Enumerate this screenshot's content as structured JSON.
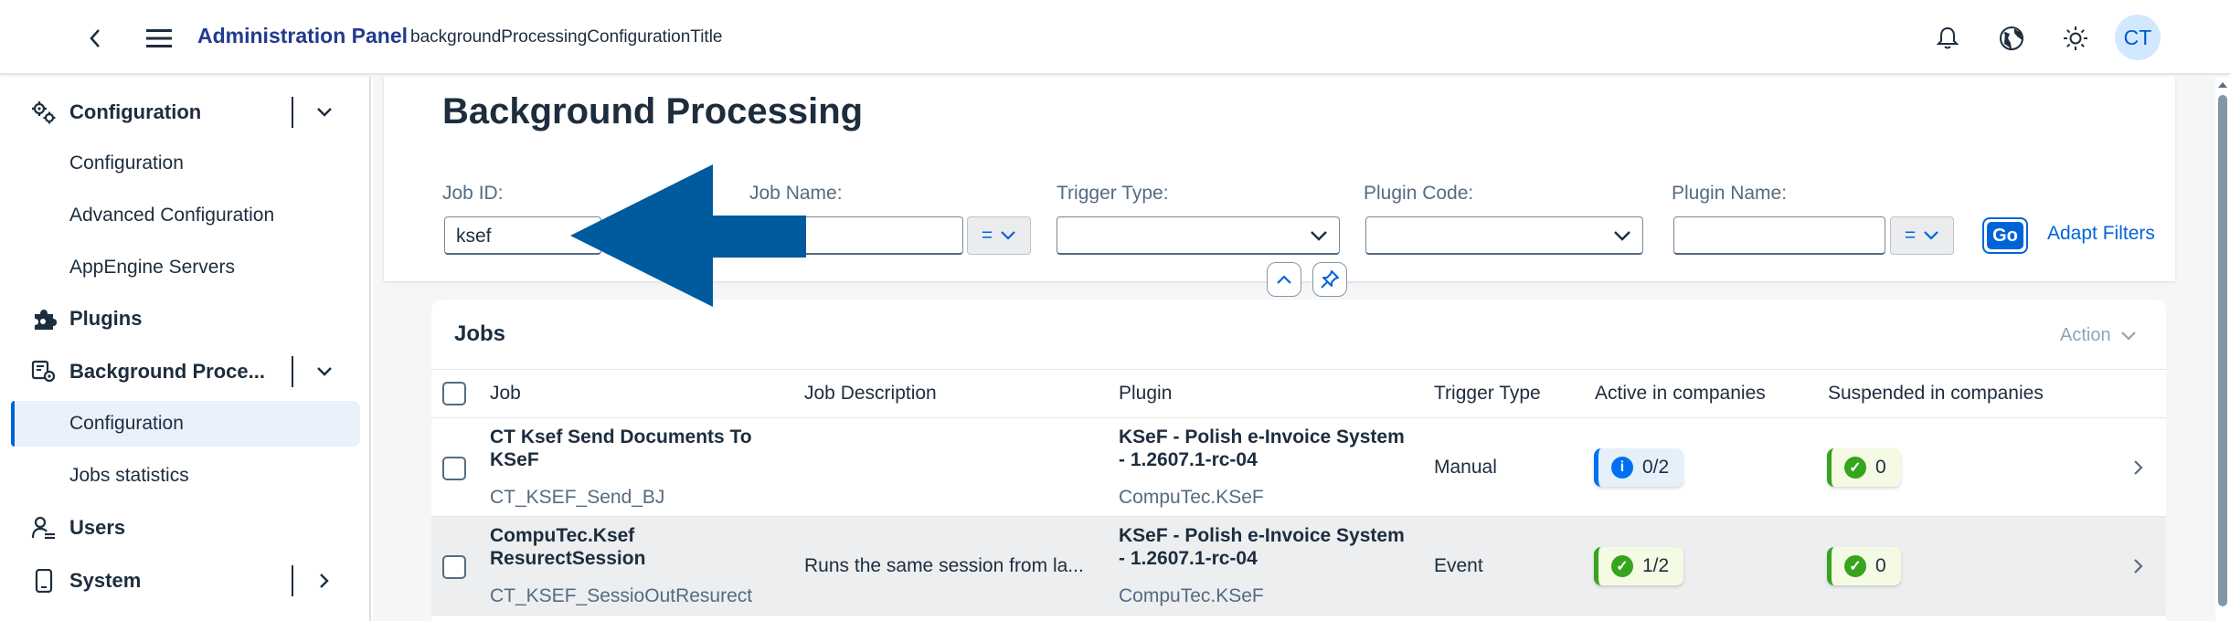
{
  "shell": {
    "title": "Administration Panel",
    "subtitle": "backgroundProcessingConfigurationTitle",
    "avatar_initials": "CT",
    "icons": [
      "back-icon",
      "hamburger-menu-icon",
      "bell-icon",
      "globe-icon",
      "sun-icon"
    ]
  },
  "sidebar": {
    "items": [
      {
        "label": "Configuration",
        "icon": "gears-icon",
        "expandable": true
      },
      {
        "label": "Configuration"
      },
      {
        "label": "Advanced Configuration"
      },
      {
        "label": "AppEngine Servers"
      },
      {
        "label": "Plugins",
        "icon": "puzzle-icon"
      },
      {
        "label": "Background Proce...",
        "icon": "processing-icon",
        "expandable": true
      },
      {
        "label": "Configuration",
        "selected": true
      },
      {
        "label": "Jobs statistics"
      },
      {
        "label": "Users",
        "icon": "users-icon"
      },
      {
        "label": "System",
        "icon": "device-icon",
        "expandable": true
      }
    ]
  },
  "page": {
    "title": "Background Processing"
  },
  "filters": {
    "job_id_label": "Job ID:",
    "job_id_value": "ksef",
    "job_name_label": "Job Name:",
    "job_name_value": "",
    "trigger_type_label": "Trigger Type:",
    "plugin_code_label": "Plugin Code:",
    "plugin_name_label": "Plugin Name:",
    "plugin_name_value": "",
    "operator": "=",
    "go_label": "Go",
    "adapt_label": "Adapt Filters"
  },
  "table": {
    "title": "Jobs",
    "action_label": "Action",
    "columns": [
      "Job",
      "Job Description",
      "Plugin",
      "Trigger Type",
      "Active in companies",
      "Suspended in companies"
    ],
    "rows": [
      {
        "job_name": "CT Ksef Send Documents To KSeF",
        "job_id": "CT_KSEF_Send_BJ",
        "description": "",
        "plugin_name": "KSeF - Polish e-Invoice System - 1.2607.1-rc-04",
        "plugin_code": "CompuTec.KSeF",
        "trigger_type": "Manual",
        "active": "0/2",
        "active_state": "info",
        "suspended": "0",
        "selected": false
      },
      {
        "job_name": "CompuTec.Ksef ResurectSession",
        "job_id": "CT_KSEF_SessioOutResurect",
        "description": "Runs the same session from la...",
        "plugin_name": "KSeF - Polish e-Invoice System - 1.2607.1-rc-04",
        "plugin_code": "CompuTec.KSeF",
        "trigger_type": "Event",
        "active": "1/2",
        "active_state": "success",
        "suspended": "0",
        "selected": true
      }
    ]
  },
  "colors": {
    "brand": "#223a8f",
    "accent": "#0064d9",
    "annotation_arrow": "#005a9e",
    "success": "#36a41d",
    "info": "#0070f2"
  }
}
